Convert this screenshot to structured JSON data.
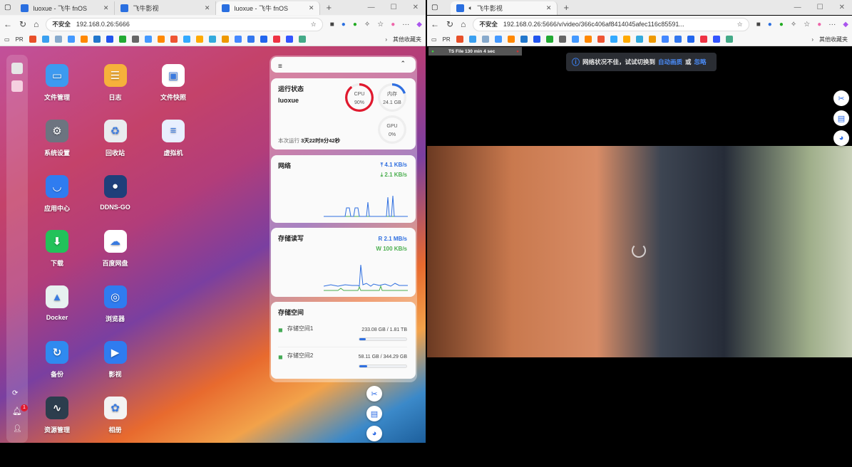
{
  "left_window": {
    "tabs": [
      {
        "label": "luoxue - 飞牛 fnOS"
      },
      {
        "label": "飞牛影视"
      },
      {
        "label": "luoxue - 飞牛 fnOS"
      }
    ],
    "security": "不安全",
    "url": "192.168.0.26:5666",
    "bookmarks_first": "PR",
    "bookmarks_other": "其他收藏夹",
    "apps": [
      {
        "label": "文件管理",
        "color": "#3d9af0",
        "glyph": "▭"
      },
      {
        "label": "日志",
        "color": "#f6b13b",
        "glyph": "☰"
      },
      {
        "label": "文件快照",
        "color": "#ffffff",
        "glyph": "▣"
      },
      {
        "label": "系统设置",
        "color": "#6d7480",
        "glyph": "⚙"
      },
      {
        "label": "回收站",
        "color": "#e9ecef",
        "glyph": "♻"
      },
      {
        "label": "虚拟机",
        "color": "#e8efff",
        "glyph": "≡"
      },
      {
        "label": "应用中心",
        "color": "#2f7cf0",
        "glyph": "◡"
      },
      {
        "label": "DDNS-GO",
        "color": "#1f3f7a",
        "glyph": "●"
      },
      {
        "label": "下载",
        "color": "#22c25a",
        "glyph": "⬇"
      },
      {
        "label": "百度网盘",
        "color": "#ffffff",
        "glyph": "☁"
      },
      {
        "label": "Docker",
        "color": "#e7f1f0",
        "glyph": "▲"
      },
      {
        "label": "浏览器",
        "color": "#2f7cf0",
        "glyph": "◎"
      },
      {
        "label": "备份",
        "color": "#2f8af0",
        "glyph": "↻"
      },
      {
        "label": "影视",
        "color": "#2f7cf0",
        "glyph": "▶"
      },
      {
        "label": "资源管理",
        "color": "#2c3d4d",
        "glyph": "∿"
      },
      {
        "label": "相册",
        "color": "#f3f3f3",
        "glyph": "✿"
      }
    ],
    "notification_count": "1",
    "widget": {
      "status": {
        "title": "运行状态",
        "host": "luoxue",
        "cpu_label": "CPU",
        "cpu_value": "90%",
        "cpu_pct": 90,
        "mem_label": "内存",
        "mem_value": "24.1 GB",
        "mem_pct": 20,
        "gpu_label": "GPU",
        "gpu_value": "0%",
        "uptime_label": "本次运行",
        "uptime": "3天22时8分42秒"
      },
      "network": {
        "title": "网络",
        "up": "4.1 KB/s",
        "down": "2.1 KB/s"
      },
      "disk_io": {
        "title": "存储读写",
        "read": "R  2.1 MB/s",
        "write": "W  100 KB/s"
      },
      "storage": {
        "title": "存储空间",
        "volumes": [
          {
            "name": "存储空间1",
            "usage": "233.08 GB / 1.81 TB",
            "pct": 13
          },
          {
            "name": "存储空间2",
            "usage": "58.11 GB / 344.29 GB",
            "pct": 17
          }
        ]
      }
    }
  },
  "right_window": {
    "tab": "飞牛影视",
    "security": "不安全",
    "url": "192.168.0.26:5666/v/video/366c406af8414045afec116c85591...",
    "bookmarks_first": "PR",
    "bookmarks_other": "其他收藏夹",
    "overlay_badge": "TS File 130 min 4 sec",
    "toast": {
      "text": "网络状况不佳，试试切换到",
      "link1": "自动画质",
      "or": "或",
      "link2": "忽略"
    }
  },
  "colors": {
    "accent": "#2f6fe0",
    "cpu": "#e0192e",
    "green": "#4caf50"
  }
}
